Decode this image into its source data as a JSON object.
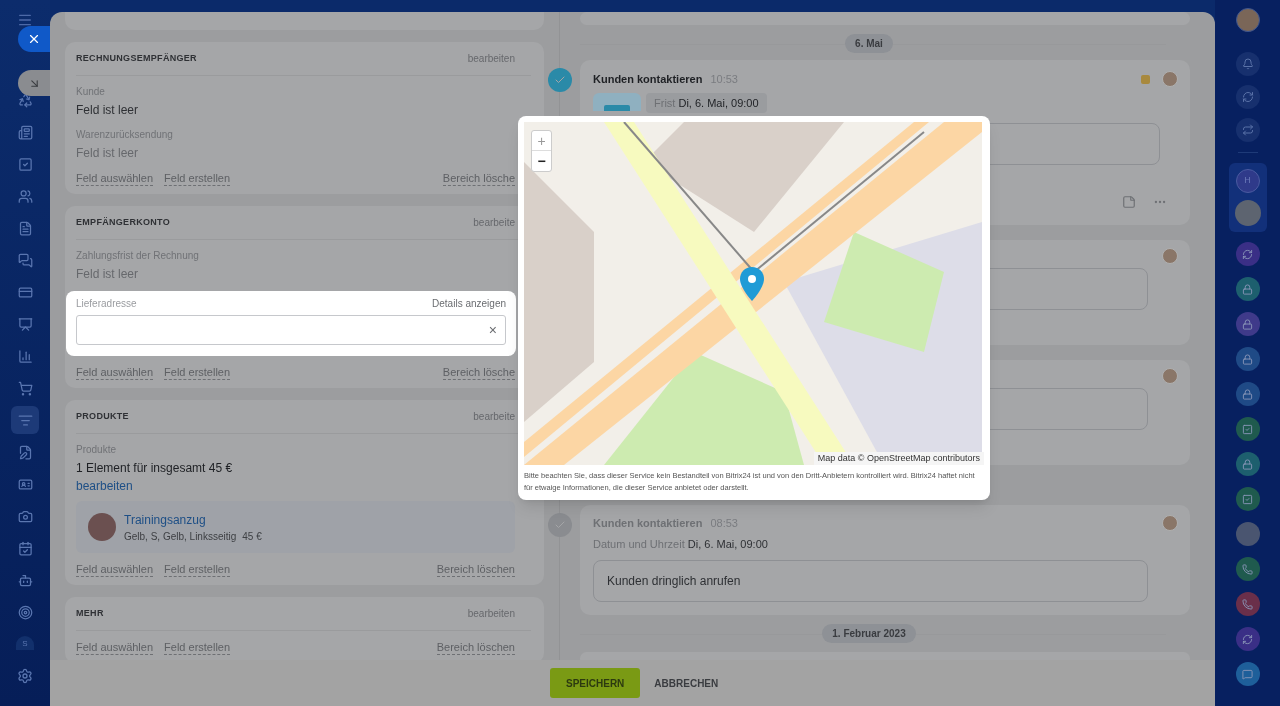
{
  "left_rail": {
    "profile_letter": "S"
  },
  "form": {
    "sections": [
      {
        "title": "RECHNUNGSEMPFÄNGER",
        "edit": "bearbeiten",
        "fields": [
          {
            "kind": "text",
            "label": "Kunde",
            "value": "Feld ist leer",
            "muted": false
          },
          {
            "kind": "text",
            "label": "Warenzurücksendung",
            "value": "Feld ist leer",
            "muted": true
          }
        ],
        "links": {
          "select": "Feld auswählen",
          "create": "Feld erstellen",
          "delete": "Bereich lösche"
        }
      },
      {
        "title": "EMPFÄNGERKONTO",
        "edit": "bearbeite",
        "fields": [
          {
            "kind": "text",
            "label": "Zahlungsfrist der Rechnung",
            "value": "Feld ist leer",
            "muted": true
          },
          {
            "kind": "address",
            "label": "Lieferadresse",
            "details": "Details anzeigen",
            "clear": "×"
          }
        ],
        "links": {
          "select": "Feld auswählen",
          "create": "Feld erstellen",
          "delete": "Bereich lösche"
        }
      },
      {
        "title": "PRODUKTE",
        "edit": "bearbeite",
        "fields": [
          {
            "kind": "products",
            "label": "Produkte",
            "summary": "1 Element für insgesamt 45 €",
            "edit": "bearbeiten",
            "items": [
              {
                "name": "Trainingsanzug",
                "variant": "Gelb, S, Gelb, Linksseitig",
                "price": "45 €"
              }
            ]
          }
        ],
        "links": {
          "select": "Feld auswählen",
          "create": "Feld erstellen",
          "delete": "Bereich löschen"
        }
      },
      {
        "title": "MEHR",
        "edit": "bearbeiten",
        "links": {
          "select": "Feld auswählen",
          "create": "Feld erstellen",
          "delete": "Bereich löschen"
        }
      }
    ]
  },
  "timeline": [
    {
      "kind": "stub"
    },
    {
      "kind": "date",
      "label": "6. Mai"
    },
    {
      "kind": "activity",
      "completed": false,
      "title": "Kunden kontaktieren",
      "time": "10:53",
      "color": "#a8893e",
      "deadline_label": "Frist",
      "deadline": "Di, 6. Mai, 09:00"
    },
    {
      "kind": "comment"
    },
    {
      "kind": "comment"
    },
    {
      "kind": "activity",
      "completed": true,
      "title": "Kunden kontaktieren",
      "time": "08:53",
      "deadline_label": "Datum und Uhrzeit",
      "deadline": "Di, 6. Mai, 09:00",
      "note": "Kunden dringlich anrufen"
    },
    {
      "kind": "date",
      "label": "1. Februar 2023"
    },
    {
      "kind": "stub"
    }
  ],
  "map_popup": {
    "zoom_in": "+",
    "zoom_out": "−",
    "attribution": "Map data © OpenStreetMap contributors",
    "disclaimer": "Bitte beachten Sie, dass dieser Service kein Bestandteil von Bitrix24 ist und von den Dritt-Anbietern kontrolliert wird. Bitrix24 haftet nicht für etwaige Informationen, die dieser Service anbietet oder darstellt."
  },
  "footer": {
    "save": "SPEICHERN",
    "cancel": "ABBRECHEN"
  },
  "right_rail": {
    "group_letter": "H",
    "chats": [
      {
        "kind": "sync",
        "color": "#3a2f86"
      },
      {
        "kind": "lock",
        "color": "#1d5f6e"
      },
      {
        "kind": "lock",
        "color": "#3f3a8a"
      },
      {
        "kind": "lock",
        "color": "#1f4a86"
      },
      {
        "kind": "lock",
        "color": "#1f4a86"
      },
      {
        "kind": "check",
        "color": "#1f5a4e"
      },
      {
        "kind": "lock",
        "color": "#1d5f6e"
      },
      {
        "kind": "check",
        "color": "#1f5a4e"
      },
      {
        "kind": "avatar",
        "color": "#4a5570"
      },
      {
        "kind": "phone",
        "color": "#1f5a4e"
      },
      {
        "kind": "phone",
        "color": "#6a2f4a"
      },
      {
        "kind": "sync",
        "color": "#3a2f86"
      },
      {
        "kind": "chat",
        "color": "#1e5f9a"
      }
    ]
  }
}
